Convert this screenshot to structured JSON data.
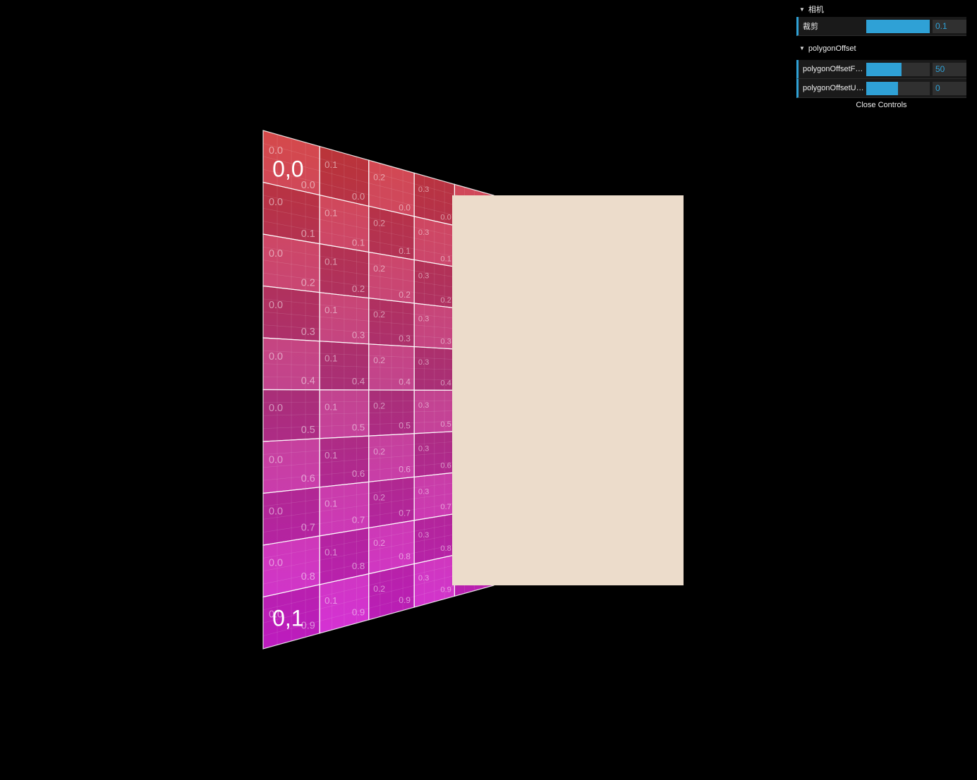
{
  "gui": {
    "folders": [
      {
        "title": "相机",
        "controls": [
          {
            "label": "裁剪",
            "value": "0.1",
            "fill": 1.0
          }
        ]
      },
      {
        "title": "polygonOffset",
        "controls": [
          {
            "label": "polygonOffsetFactor",
            "display_label": "polygonOffsetF…",
            "value": "50",
            "fill": 0.55
          },
          {
            "label": "polygonOffsetUnits",
            "display_label": "polygonOffsetU…",
            "value": "0",
            "fill": 0.5
          }
        ]
      }
    ],
    "close_label": "Close Controls"
  },
  "scene": {
    "textured_plane": {
      "corner_labels": {
        "top": "0,0",
        "bottom": "0,1"
      },
      "u_labels": [
        "0.0",
        "0.1",
        "0.2",
        "0.3"
      ],
      "v_labels": [
        "0.0",
        "0.1",
        "0.2",
        "0.3",
        "0.4",
        "0.5",
        "0.6",
        "0.7",
        "0.8",
        "0.9"
      ]
    },
    "colors": {
      "background": "#000000",
      "occluding_plane": "#ecdccb",
      "texture_top": "#d23a3a",
      "texture_bottom": "#d31fd6"
    }
  }
}
